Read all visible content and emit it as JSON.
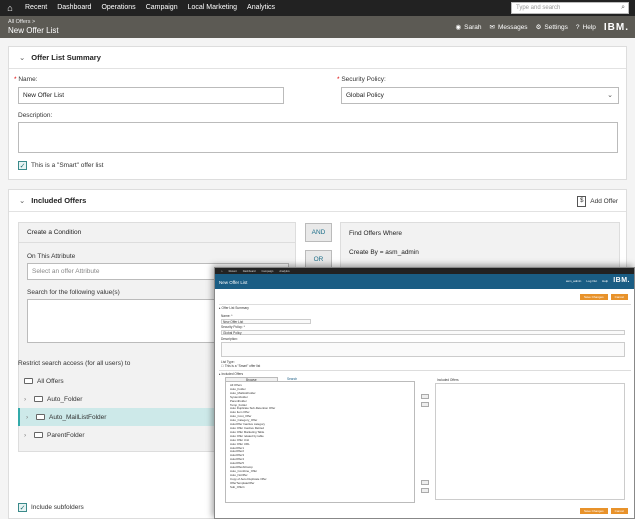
{
  "topnav": {
    "items": [
      "Recent",
      "Dashboard",
      "Operations",
      "Campaign",
      "Local Marketing",
      "Analytics"
    ],
    "search_placeholder": "Type and search"
  },
  "header": {
    "breadcrumb": "All Offers >",
    "title": "New Offer List",
    "user": "Sarah",
    "messages": "Messages",
    "settings": "Settings",
    "help": "Help",
    "brand": "IBM."
  },
  "summary": {
    "title": "Offer List Summary",
    "name_label": "Name:",
    "name_value": "New Offer List",
    "security_label": "Security Policy:",
    "security_value": "Global Policy",
    "description_label": "Description:",
    "smart_label": "This is a \"Smart\" offer list"
  },
  "included": {
    "title": "Included Offers",
    "add_offer": "Add Offer",
    "create_condition": "Create a Condition",
    "on_attribute_label": "On This Attribute",
    "attribute_placeholder": "Select an offer Attribute",
    "search_values_label": "Search for the following value(s)",
    "and_label": "AND",
    "or_label": "OR",
    "find_title": "Find Offers Where",
    "find_rule": "Create By = asm_admin",
    "restrict_label": "Restrict search access (for all users) to",
    "folders": [
      "All Offers",
      "Auto_Folder",
      "Auto_MailListFolder",
      "ParentFolder"
    ],
    "include_subfolders": "Include subfolders"
  },
  "overlay": {
    "nav": [
      "Recent",
      "Dashboard",
      "Campaign",
      "Analytics"
    ],
    "title": "New Offer List",
    "header_right": [
      "asm_admin",
      "Log Out",
      "Help"
    ],
    "brand": "IBM.",
    "save_button": "Save Changes",
    "cancel_button": "Cancel",
    "summary_title": "Offer List Summary",
    "name_label": "Name: *",
    "name_value": "New Offer List",
    "policy_label": "Security Policy: *",
    "policy_value": "Global Policy",
    "description_label": "Description:",
    "list_type_label": "List Type:",
    "smart_label": "This is a \"Smart\" offer list",
    "included_title": "Included Offers",
    "browse_tab": "Browse",
    "search_tab": "Search",
    "included_offers_label": "Included Offers",
    "tree": [
      "All Offers",
      "Auto_Folder",
      "Auto_MailListFolder",
      "SystemFolder",
      "ParentFolder",
      "Temp_Folder",
      "Auto Duplicate Sub-Retention Offer",
      "Auto Item Offer",
      "Auto_Cost_Offer",
      "Auto_Category_Offer",
      "AutoOffer Inactive category",
      "Auto Offer Inactive Retired",
      "Auto Offer Marketing Table",
      "Auto Offer related by table",
      "Auto Offer Unit",
      "Auto Offer URL",
      "AutoOffer1",
      "AutoOffer2",
      "AutoOffer3",
      "AutoOffer4",
      "AutoOffer5",
      "AutoOfferAtCamp",
      "Auto_Combine_Offer",
      "Auto_NoOffer",
      "Copy of Auto Duplicate Offer",
      "OfferTemplateOffer",
      "Sub_Offer1"
    ]
  }
}
